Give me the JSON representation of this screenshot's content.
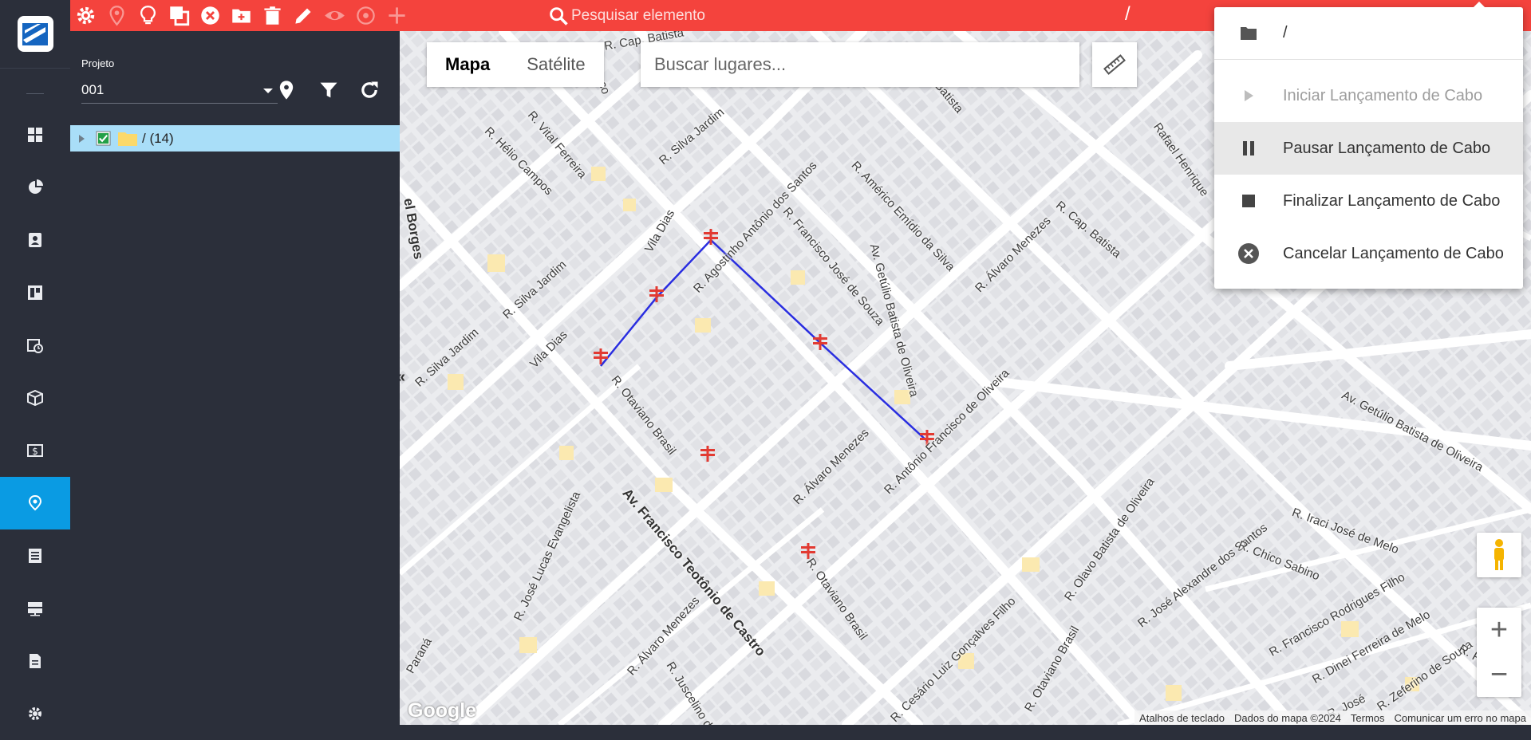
{
  "toolbar": {
    "icons": [
      "gear-icon",
      "map-pin-icon",
      "lightbulb-icon",
      "copy-icon",
      "cancel-icon",
      "folder-add-icon",
      "trash-icon",
      "pencil-icon",
      "eye-icon",
      "location-icon",
      "plus-icon"
    ],
    "search_placeholder": "Pesquisar elemento",
    "path": "/"
  },
  "nav": {
    "items": [
      "dashboard-icon",
      "pie-chart-icon",
      "contact-card-icon",
      "board-icon",
      "calendar-clock-icon",
      "box-icon",
      "money-icon",
      "map-icon",
      "list-icon",
      "server-icon",
      "document-icon",
      "settings-icon"
    ],
    "active_index": 7
  },
  "panel": {
    "project_label": "Projeto",
    "project_value": "001",
    "tree_item": "/ (14)"
  },
  "map": {
    "type_options": [
      "Mapa",
      "Satélite"
    ],
    "selected_type": "Mapa",
    "places_placeholder": "Buscar lugares...",
    "google_logo": "Google",
    "attribution": [
      "Atalhos de teclado",
      "Dados do mapa ©2024",
      "Termos",
      "Comunicar um erro no mapa"
    ],
    "streets": [
      "R. Cap. Batista",
      "R. Hélio Campos",
      "R. Vital Ferreira",
      "R. Silva Jardim",
      "rnambuco",
      "R. Agostinho Antônio dos Santos",
      "R. Américo Emídio da Silva",
      "R. Francisco José de Souza",
      "Vila Dias",
      "R. Silva Jardim",
      "R. Silva Jardim",
      "Vila Dias",
      "R. Otaviano Brasil",
      "R. Álvaro Menezes",
      "R. Álvaro Menezes",
      "R. Antônio Francisco de Oliveira",
      "Av. Francisco Teotônio de Castro",
      "R. José Lucas Evangelista",
      "R. Otaviano Brasil",
      "R. Álvaro Menezes",
      "R. Cesário Luiz Gonçalves Filho",
      "R. Otaviano Brasil",
      "R. Olavo Batista de Oliveira",
      "R. José Alexandre dos Santos",
      "R. Chico Sabino",
      "R. Francisco Rodrigues Filho",
      "R. Dinei Ferreira de Melo",
      "R. Iraci José de Melo",
      "Av. Getúlio Batista de Oliveira",
      "Av. Getúlio Batista de Oliveira",
      "R. Cap. Batista",
      "Rafael Henrique",
      "el Borges",
      "Paraná",
      "R. Juscelino de",
      "R. Zeferino de Souza",
      "R. Rica",
      "R. José",
      "Batista"
    ]
  },
  "menu": {
    "header": "/",
    "items": [
      {
        "label": "Iniciar Lançamento de Cabo",
        "icon": "play-icon",
        "state": "disabled"
      },
      {
        "label": "Pausar Lançamento de Cabo",
        "icon": "pause-icon",
        "state": "hover"
      },
      {
        "label": "Finalizar Lançamento de Cabo",
        "icon": "stop-icon",
        "state": "normal"
      },
      {
        "label": "Cancelar Lançamento de Cabo",
        "icon": "cancel-circle-icon",
        "state": "normal"
      }
    ]
  },
  "colors": {
    "toolbar": "#f4433d",
    "sidebar": "#2b2f3a",
    "active_nav": "#0a9be3",
    "tree_row": "#a9def8",
    "cable_line": "#2a2ee0",
    "pole_marker": "#e23a32"
  }
}
